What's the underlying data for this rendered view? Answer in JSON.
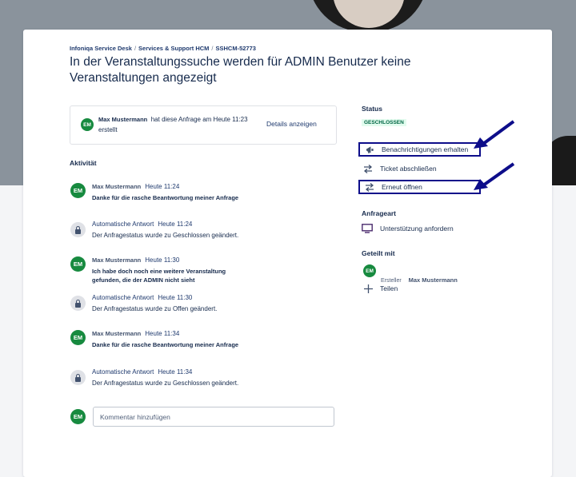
{
  "breadcrumb": {
    "project": "Infoniqa Service Desk",
    "portal": "Services & Support HCM",
    "ticket": "SSHCM-52773",
    "separator": "/"
  },
  "title": "In der Veranstaltungssuche werden für ADMIN Benutzer keine Veranstaltungen angezeigt",
  "creator": {
    "avatar": "EM",
    "name": "Max Mustermann",
    "text": "hat diese Anfrage am Heute 11:23 erstellt",
    "details_link": "Details anzeigen"
  },
  "activity": {
    "heading": "Aktivität",
    "items": [
      {
        "avatar": "EM",
        "author": "Max Mustermann",
        "time": "Heute 11:24",
        "text": "Danke für die rasche Beantwortung meiner Anfrage"
      },
      {
        "avatar": "lock-icon",
        "author": "Automatische Antwort",
        "time": "Heute 11:24",
        "text": "Der Anfragestatus wurde zu Geschlossen geändert."
      },
      {
        "avatar": "EM",
        "author": "Max Mustermann",
        "time": "Heute 11:30",
        "text": "Ich habe doch noch eine weitere Veranstaltung gefunden, die der ADMIN nicht sieht"
      },
      {
        "avatar": "lock-icon",
        "author": "Automatische Antwort",
        "time": "Heute 11:30",
        "text": "Der Anfragestatus wurde zu Offen geändert."
      },
      {
        "avatar": "EM",
        "author": "Max Mustermann",
        "time": "Heute 11:34",
        "text": "Danke für die rasche Beantwortung meiner Anfrage"
      },
      {
        "avatar": "lock-icon",
        "author": "Automatische Antwort",
        "time": "Heute 11:34",
        "text": "Der Anfragestatus wurde zu Geschlossen geändert."
      }
    ]
  },
  "comment": {
    "avatar": "EM",
    "placeholder": "Kommentar hinzufügen"
  },
  "sidebar": {
    "status_label": "Status",
    "status_value": "GESCHLOSSEN",
    "status_color": "#006644",
    "actions": [
      {
        "label": "Benachrichtigungen erhalten",
        "icon": "megaphone-icon"
      },
      {
        "label": "Ticket abschließen",
        "icon": "swap-arrows-icon"
      },
      {
        "label": "Erneut öffnen",
        "icon": "swap-arrows-icon"
      }
    ],
    "request_type_label": "Anfrageart",
    "request_type": {
      "label": "Unterstützung anfordern",
      "icon": "monitor-icon"
    },
    "shared_label": "Geteilt mit",
    "shared_avatar": "EM",
    "shared_role": "Ersteller",
    "shared_name": "Max Mustermann",
    "share_button": "Teilen"
  },
  "colors": {
    "accent": "#1f3a6e",
    "avatar": "#178a3f",
    "highlight": "#0d0d8a"
  }
}
